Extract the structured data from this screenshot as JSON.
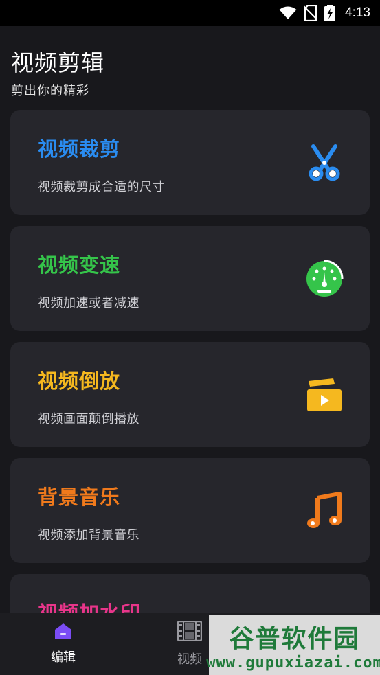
{
  "status_bar": {
    "time": "4:13",
    "icons": [
      "wifi-icon",
      "no-sim-icon",
      "battery-charging-icon"
    ]
  },
  "header": {
    "title": "视频剪辑",
    "subtitle": "剪出你的精彩"
  },
  "cards": [
    {
      "title": "视频裁剪",
      "desc": "视频裁剪成合适的尺寸",
      "color": "#2a8cf0",
      "icon": "scissors-icon"
    },
    {
      "title": "视频变速",
      "desc": "视频加速或者减速",
      "color": "#35c44a",
      "icon": "speedometer-icon"
    },
    {
      "title": "视频倒放",
      "desc": "视频画面颠倒播放",
      "color": "#f5b81f",
      "icon": "reverse-play-icon"
    },
    {
      "title": "背景音乐",
      "desc": "视频添加背景音乐",
      "color": "#f07a1c",
      "icon": "music-note-icon"
    },
    {
      "title": "视频加水印",
      "color": "#e8358a"
    }
  ],
  "bottom_nav": {
    "items": [
      {
        "label": "编辑",
        "icon": "home-icon",
        "active": true,
        "accent": "#7b4cf5"
      },
      {
        "label": "视频",
        "icon": "film-icon",
        "active": false
      }
    ]
  },
  "watermark": {
    "main": "谷普软件园",
    "sub": "www.gupuxiazai.com"
  }
}
